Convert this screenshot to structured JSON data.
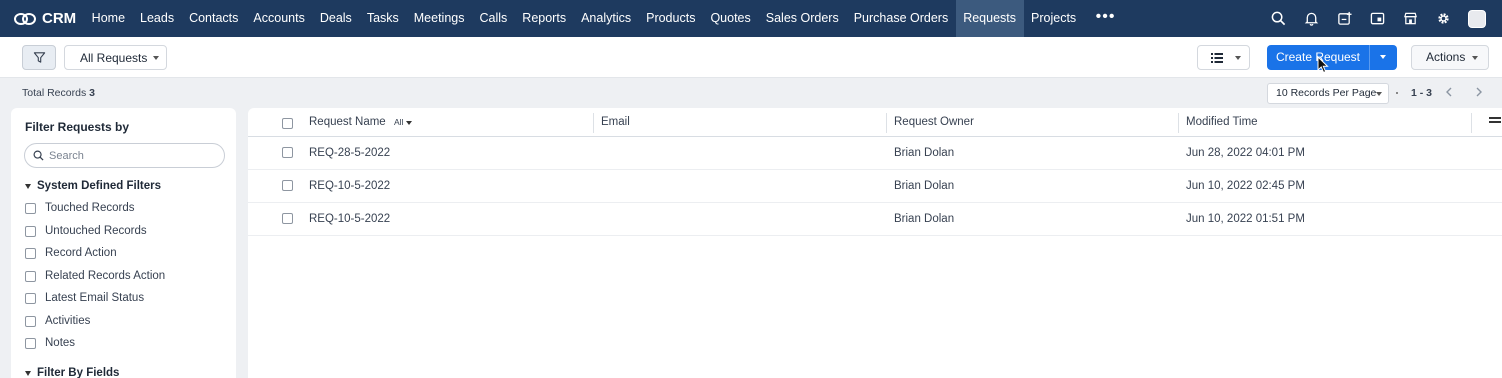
{
  "app": {
    "name": "CRM"
  },
  "nav": {
    "items": [
      "Home",
      "Leads",
      "Contacts",
      "Accounts",
      "Deals",
      "Tasks",
      "Meetings",
      "Calls",
      "Reports",
      "Analytics",
      "Products",
      "Quotes",
      "Sales Orders",
      "Purchase Orders",
      "Requests",
      "Projects"
    ],
    "active": "Requests",
    "more": "•••"
  },
  "top_icons": [
    "search-icon",
    "bell-icon",
    "calendar-add-icon",
    "window-icon",
    "store-icon",
    "gear-icon",
    "avatar"
  ],
  "toolbar": {
    "view_label": "All Requests",
    "create_label": "Create Request",
    "actions_label": "Actions"
  },
  "summary": {
    "total_label": "Total Records",
    "total_count": "3",
    "per_page": "10 Records Per Page",
    "range": "1 - 3"
  },
  "sidebar": {
    "title": "Filter Requests by",
    "search_placeholder": "Search",
    "system_group": "System Defined Filters",
    "system_filters": [
      "Touched Records",
      "Untouched Records",
      "Record Action",
      "Related Records Action",
      "Latest Email Status",
      "Activities",
      "Notes"
    ],
    "fields_group": "Filter By Fields"
  },
  "table": {
    "columns": [
      "Request Name",
      "Email",
      "Request Owner",
      "Modified Time"
    ],
    "name_filter": "All",
    "rows": [
      {
        "name": "REQ-28-5-2022",
        "email": "",
        "owner": "Brian Dolan",
        "modified": "Jun 28, 2022 04:01 PM"
      },
      {
        "name": "REQ-10-5-2022",
        "email": "",
        "owner": "Brian Dolan",
        "modified": "Jun 10, 2022 02:45 PM"
      },
      {
        "name": "REQ-10-5-2022",
        "email": "",
        "owner": "Brian Dolan",
        "modified": "Jun 10, 2022 01:51 PM"
      }
    ]
  },
  "colors": {
    "topbar": "#1e3a5f",
    "active_nav": "#3c5a7e",
    "primary": "#1a73e8"
  }
}
